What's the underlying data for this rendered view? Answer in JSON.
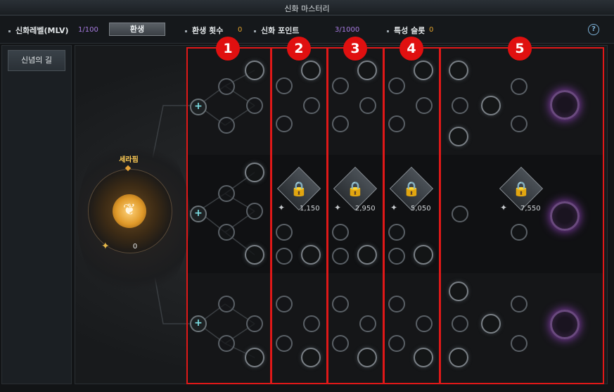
{
  "window": {
    "title": "신화 마스터리"
  },
  "status": {
    "mythic_level_label": "신화레벨(MLV)",
    "mythic_level_value": "1/100",
    "rebirth_button": "환생",
    "rebirth_count_label": "환생 횟수",
    "rebirth_count_value": "0",
    "mythic_points_label": "신화 포인트",
    "mythic_points_value": "3/1000",
    "trait_slot_label": "특성 슬롯",
    "trait_slot_value": "0",
    "help_label": "?"
  },
  "sidebar": {
    "tab_label": "신념의 길"
  },
  "core": {
    "name": "세라핌",
    "points": "0"
  },
  "columns": [
    {
      "badge": "1",
      "cost": ""
    },
    {
      "badge": "2",
      "cost": "1,150"
    },
    {
      "badge": "3",
      "cost": "2,950"
    },
    {
      "badge": "4",
      "cost": "5,050"
    },
    {
      "badge": "5",
      "cost": "7,550"
    }
  ],
  "colors": {
    "accent_purple": "#a77be0",
    "accent_orange": "#e0a12c",
    "highlight_red": "#e01818"
  }
}
